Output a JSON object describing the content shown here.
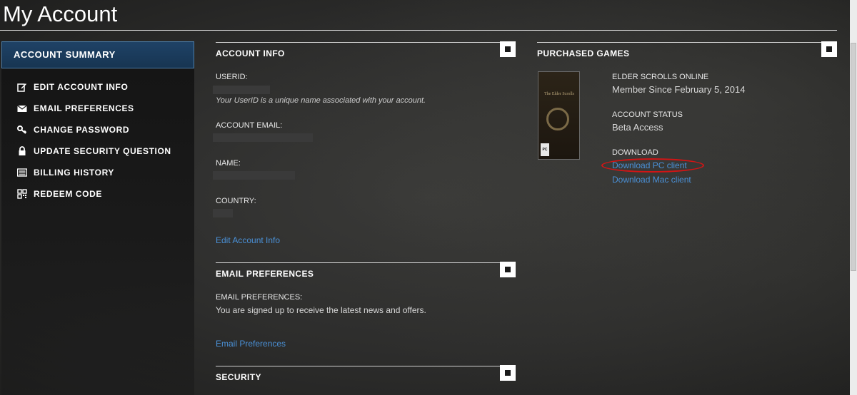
{
  "page": {
    "title": "My Account"
  },
  "sidebar": {
    "active_label": "ACCOUNT SUMMARY",
    "items": [
      {
        "label": "EDIT ACCOUNT INFO",
        "icon": "edit-icon"
      },
      {
        "label": "EMAIL PREFERENCES",
        "icon": "envelope-icon"
      },
      {
        "label": "CHANGE PASSWORD",
        "icon": "key-icon"
      },
      {
        "label": "UPDATE SECURITY QUESTION",
        "icon": "lock-icon"
      },
      {
        "label": "BILLING HISTORY",
        "icon": "list-icon"
      },
      {
        "label": "REDEEM CODE",
        "icon": "qr-code-icon"
      }
    ]
  },
  "account_info": {
    "heading": "ACCOUNT INFO",
    "userid_label": "USERID:",
    "userid_help": "Your UserID is a unique name associated with your account.",
    "email_label": "ACCOUNT EMAIL:",
    "name_label": "NAME:",
    "country_label": "COUNTRY:",
    "edit_link": "Edit Account Info"
  },
  "email_preferences": {
    "heading": "EMAIL PREFERENCES",
    "label": "EMAIL PREFERENCES:",
    "status_text": "You are signed up to receive the latest news and offers.",
    "link": "Email Preferences"
  },
  "security": {
    "heading": "SECURITY"
  },
  "purchased_games": {
    "heading": "PURCHASED GAMES",
    "game": {
      "cover_title": "The Elder Scrolls",
      "cover_platform": "PC",
      "title": "ELDER SCROLLS ONLINE",
      "member_since": "Member Since February 5, 2014",
      "status_label": "ACCOUNT STATUS",
      "status_value": "Beta Access",
      "download_label": "DOWNLOAD",
      "download_pc": "Download PC client",
      "download_mac": "Download Mac client"
    }
  },
  "colors": {
    "link": "#4a90d6",
    "active_sidebar": "#1f4266",
    "annotation_circle": "#d21515"
  }
}
